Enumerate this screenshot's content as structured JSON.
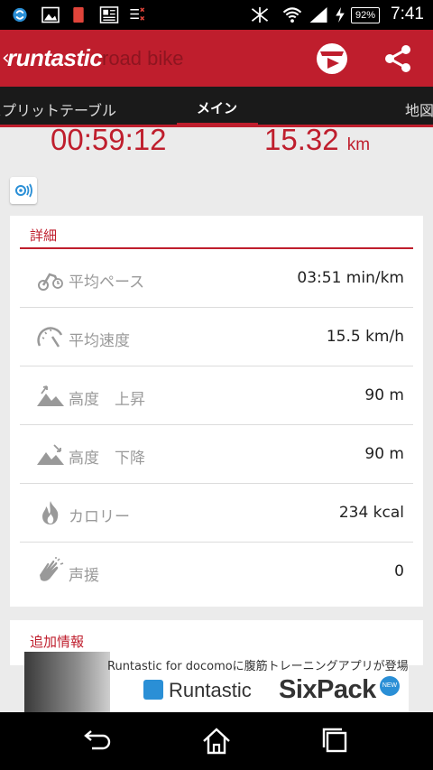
{
  "status_bar": {
    "battery": "92%",
    "time": "7:41"
  },
  "app_bar": {
    "brand": "runtastic",
    "subtitle": "road bike"
  },
  "tabs": [
    {
      "label": "スプリットテーブル"
    },
    {
      "label": "メイン"
    },
    {
      "label": "地図"
    }
  ],
  "summary": {
    "duration": "00:59:12",
    "distance": "15.32",
    "distance_unit": "km"
  },
  "details": {
    "title": "詳細",
    "rows": [
      {
        "icon": "pace-icon",
        "label": "平均ペース",
        "value": "03:51 min/km"
      },
      {
        "icon": "speedometer-icon",
        "label": "平均速度",
        "value": "15.5  km/h"
      },
      {
        "icon": "elevation-up-icon",
        "label": "高度　上昇",
        "value": "90 m"
      },
      {
        "icon": "elevation-down-icon",
        "label": "高度　下降",
        "value": "90 m"
      },
      {
        "icon": "flame-icon",
        "label": "カロリー",
        "value": "234 kcal"
      },
      {
        "icon": "cheer-icon",
        "label": "声援",
        "value": "0"
      }
    ]
  },
  "additional": {
    "title": "追加情報"
  },
  "ad": {
    "line1": "Runtastic for docomoに腹筋トレーニングアプリが登場",
    "name": "Runtastic",
    "product": "SixPack",
    "badge": "NEW"
  },
  "colors": {
    "brand_red": "#bf1e2d",
    "tab_bg": "#1a1a1a",
    "page_bg": "#ebebeb"
  }
}
